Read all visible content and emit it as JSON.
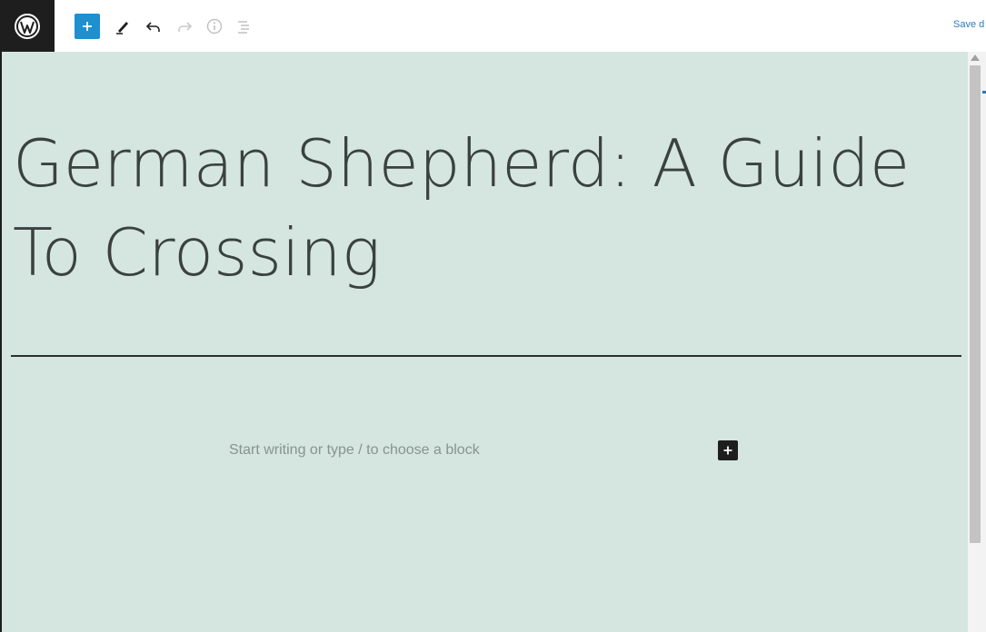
{
  "toolbar": {
    "wordpress_logo": "wordpress-logo-icon",
    "inserter_icon": "plus-icon",
    "tools_icon": "pencil-icon",
    "undo_icon": "undo-icon",
    "redo_icon": "redo-icon",
    "details_icon": "info-icon",
    "outline_icon": "list-view-icon",
    "save_draft_label": "Save d"
  },
  "editor": {
    "title": "German Shepherd: A Guide To Crossing",
    "block_placeholder": "Start writing or type / to choose a block",
    "add_block_icon": "plus-icon"
  },
  "colors": {
    "canvas_background": "#d4e6df",
    "accent": "#1e8fcf",
    "logo_background": "#1e1e1e"
  }
}
